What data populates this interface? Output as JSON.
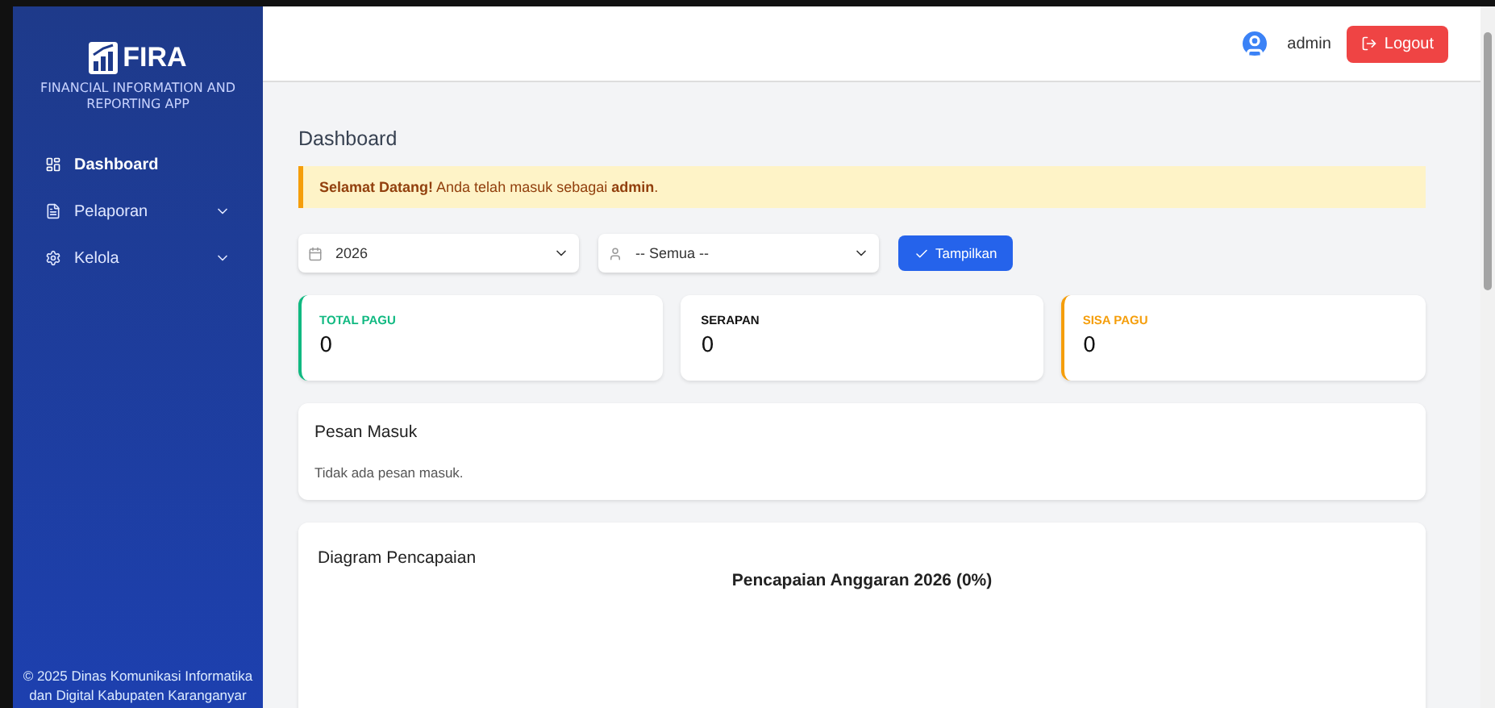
{
  "sidebar": {
    "brand": "FIRA",
    "subtitle": "FINANCIAL INFORMATION AND REPORTING APP",
    "items": [
      {
        "label": "Dashboard",
        "kind": "link",
        "selected": true
      },
      {
        "label": "Pelaporan",
        "kind": "dropdown",
        "selected": false
      },
      {
        "label": "Kelola",
        "kind": "dropdown",
        "selected": false
      }
    ],
    "footer": "© 2025 Dinas Komunikasi Informatika dan Digital Kabupaten Karanganyar"
  },
  "header": {
    "user": "admin",
    "logout": "Logout"
  },
  "page_title": "Dashboard",
  "alert": "**Selamat Datang!** Anda telah masuk sebagai **admin**.",
  "filters": {
    "year": "2026",
    "unit": "-- Semua --",
    "button": "Tampilkan"
  },
  "stats": [
    {
      "label": "TOTAL PAGU",
      "value": "0",
      "color": "#10b981"
    },
    {
      "label": "SERAPAN",
      "value": "0"
    },
    {
      "label": "SISA PAGU",
      "value": "0",
      "color": "#f59e0b"
    }
  ],
  "messages": {
    "title": "Pesan Masuk",
    "empty": "Tidak ada pesan masuk."
  },
  "chart_card": {
    "title": "Diagram Pencapaian",
    "chart_title": "Pencapaian Anggaran 2026 (0%)"
  }
}
